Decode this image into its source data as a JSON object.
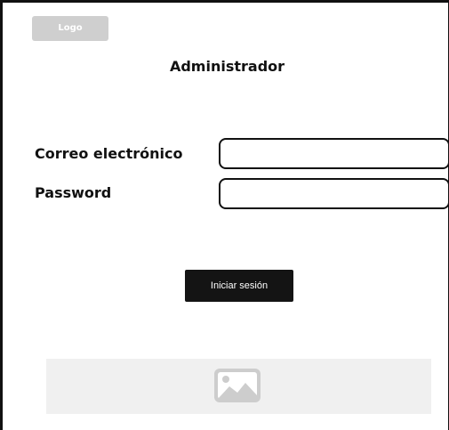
{
  "header": {
    "logo_text": "Logo",
    "title": "Administrador"
  },
  "form": {
    "email_label": "Correo electrónico",
    "email_value": "",
    "password_label": "Password",
    "password_value": "",
    "submit_label": "Iniciar sesión"
  },
  "footer": {
    "image_icon": "image-placeholder-icon"
  }
}
